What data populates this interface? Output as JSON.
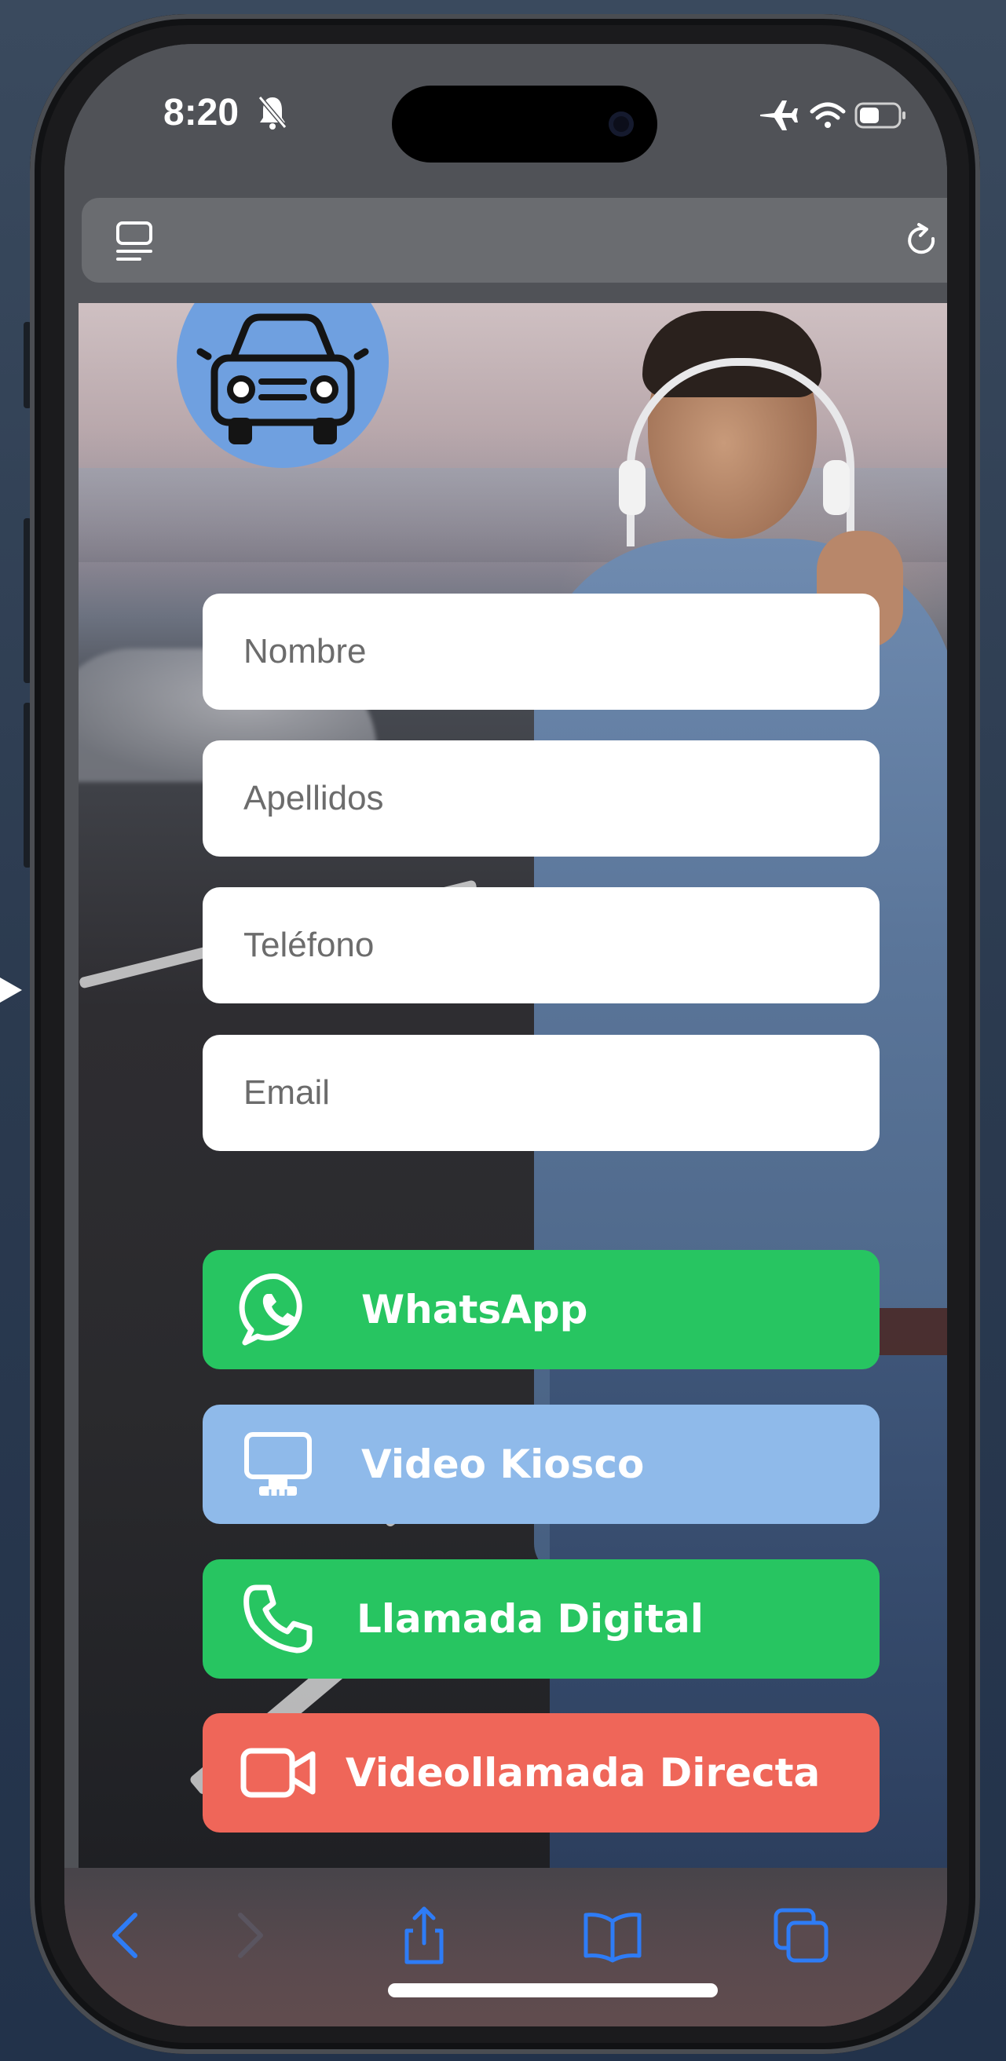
{
  "status_bar": {
    "time": "8:20",
    "icons": [
      "bell-slash-icon",
      "airplane-icon",
      "wifi-icon",
      "battery-icon"
    ]
  },
  "browser": {
    "url_bar_icons": [
      "reader-icon",
      "reload-icon"
    ],
    "toolbar_icons": [
      "back-icon",
      "forward-icon",
      "share-icon",
      "bookmarks-icon",
      "tabs-icon"
    ]
  },
  "logo": {
    "icon": "car-icon",
    "color": "#6fa0e0"
  },
  "form": {
    "nombre": {
      "placeholder": "Nombre",
      "value": ""
    },
    "apellidos": {
      "placeholder": "Apellidos",
      "value": ""
    },
    "telefono": {
      "placeholder": "Teléfono",
      "value": ""
    },
    "email": {
      "placeholder": "Email",
      "value": ""
    }
  },
  "buttons": {
    "whatsapp": {
      "label": "WhatsApp",
      "icon": "whatsapp-icon",
      "color": "#27c561"
    },
    "video_kiosco": {
      "label": "Video Kiosco",
      "icon": "monitor-icon",
      "color": "#8fbaea"
    },
    "llamada_digital": {
      "label": "Llamada Digital",
      "icon": "phone-icon",
      "color": "#27c561"
    },
    "videollamada": {
      "label": "Videollamada Directa",
      "icon": "video-camera-icon",
      "color": "#ef6659"
    }
  }
}
